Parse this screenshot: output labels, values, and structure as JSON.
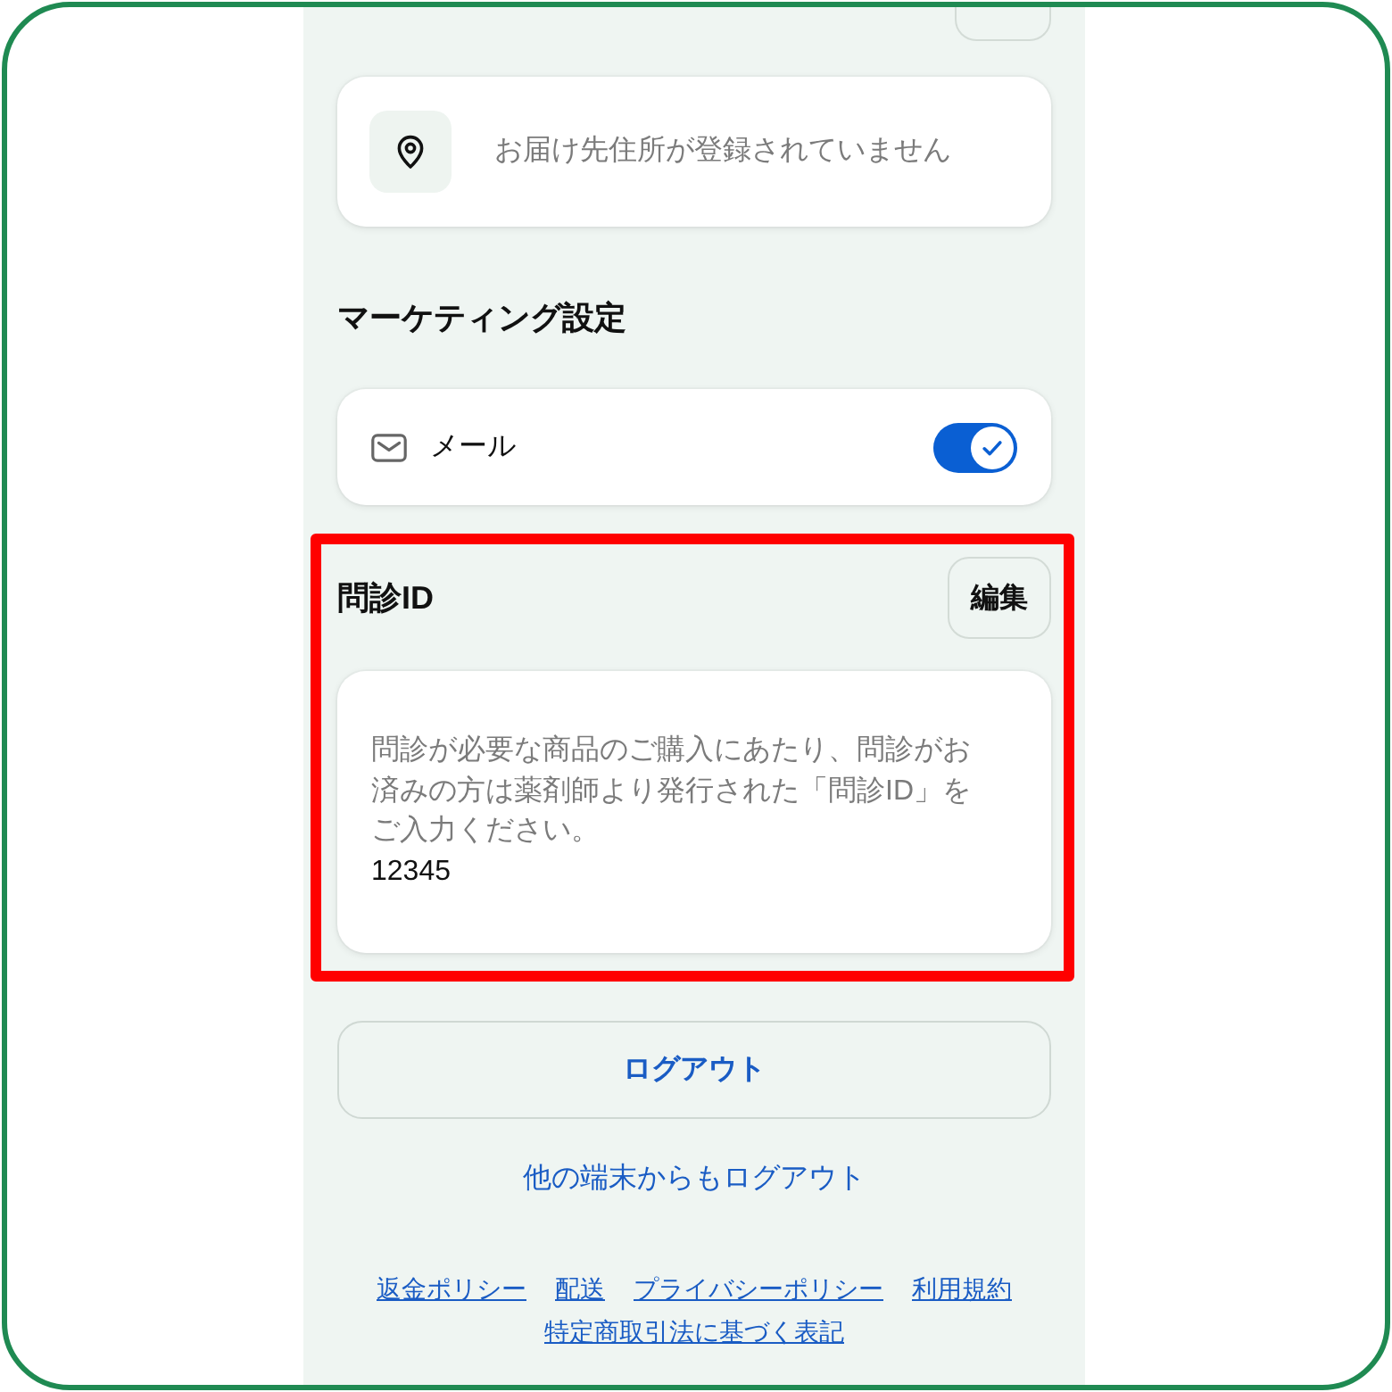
{
  "address": {
    "empty_message": "お届け先住所が登録されていません"
  },
  "marketing": {
    "heading": "マーケティング設定",
    "items": [
      {
        "label": "メール",
        "on": true
      }
    ]
  },
  "interview_id": {
    "highlighted": true,
    "heading": "問診ID",
    "edit_button": "編集",
    "description": "問診が必要な商品のご購入にあたり、問診がお済みの方は薬剤師より発行された「問診ID」をご入力ください。",
    "value": "12345"
  },
  "logout_button": "ログアウト",
  "logout_other_devices": "他の端末からもログアウト",
  "footer_links": [
    "返金ポリシー",
    "配送",
    "プライバシーポリシー",
    "利用規約",
    "特定商取引法に基づく表記"
  ]
}
